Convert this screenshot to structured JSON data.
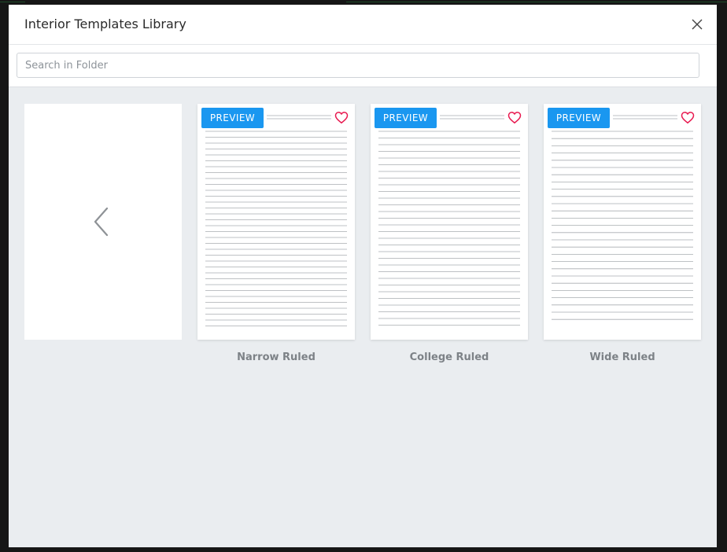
{
  "dialog": {
    "title": "Interior Templates Library"
  },
  "search": {
    "placeholder": "Search in Folder",
    "value": ""
  },
  "templates": [
    {
      "name": "Narrow Ruled",
      "preview_label": "PREVIEW",
      "favorite_icon": "heart-outline-icon"
    },
    {
      "name": "College Ruled",
      "preview_label": "PREVIEW",
      "favorite_icon": "heart-outline-icon"
    },
    {
      "name": "Wide Ruled",
      "preview_label": "PREVIEW",
      "favorite_icon": "heart-outline-icon"
    }
  ],
  "icons": {
    "close": "close-icon",
    "previous": "chevron-left-icon",
    "favorite": "heart-outline-icon"
  },
  "colors": {
    "accent": "#1a97f0",
    "heart": "#e8194f",
    "background": "#eaedf0"
  }
}
